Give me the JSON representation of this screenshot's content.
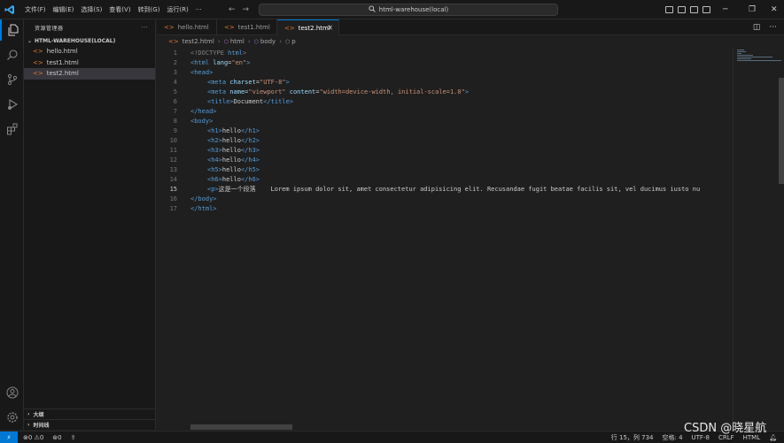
{
  "titlebar": {
    "menu": [
      "文件(F)",
      "编辑(E)",
      "选择(S)",
      "查看(V)",
      "转到(G)",
      "运行(R)",
      "···"
    ],
    "search": "html-warehouse(local)"
  },
  "sidebar": {
    "title": "资源管理器",
    "more": "···",
    "folder": "HTML-WAREHOUSE(LOCAL)",
    "files": [
      "hello.html",
      "test1.html",
      "test2.html"
    ],
    "sections": [
      "大纲",
      "时间线"
    ]
  },
  "tabs": [
    {
      "label": "hello.html"
    },
    {
      "label": "test1.html"
    },
    {
      "label": "test2.html"
    }
  ],
  "breadcrumb": [
    "test2.html",
    "html",
    "body",
    "p"
  ],
  "editor": {
    "line_numbers": [
      "1",
      "2",
      "3",
      "4",
      "5",
      "6",
      "7",
      "8",
      "9",
      "10",
      "11",
      "12",
      "13",
      "14",
      "15",
      "16",
      "17"
    ],
    "lines": {
      "l1a": "<!DOCTYPE ",
      "l1b": "html",
      "l1c": ">",
      "l2a": "<html ",
      "l2b": "lang",
      "l2c": "=",
      "l2d": "\"en\"",
      "l2e": ">",
      "l3": "<head>",
      "l4a": "<meta ",
      "l4b": "charset",
      "l4c": "=",
      "l4d": "\"UTF-8\"",
      "l4e": ">",
      "l5a": "<meta ",
      "l5b": "name",
      "l5c": "=",
      "l5d": "\"viewport\"",
      "l5e": " content",
      "l5f": "=",
      "l5g": "\"width=device-width, initial-scale=1.0\"",
      "l5h": ">",
      "l6a": "<title>",
      "l6b": "Document",
      "l6c": "</title>",
      "l7": "</head>",
      "l8": "<body>",
      "l9a": "<h1>",
      "l9b": "hello",
      "l9c": "</h1>",
      "l10a": "<h2>",
      "l10b": "hello",
      "l10c": "</h2>",
      "l11a": "<h3>",
      "l11b": "hello",
      "l11c": "</h3>",
      "l12a": "<h4>",
      "l12b": "hello",
      "l12c": "</h4>",
      "l13a": "<h5>",
      "l13b": "hello",
      "l13c": "</h5>",
      "l14a": "<h6>",
      "l14b": "hello",
      "l14c": "</h6>",
      "l15a": "<p>",
      "l15b": "这是一个段落",
      "l15c": "    Lorem ipsum dolor sit, amet consectetur adipisicing elit. Recusandae fugit beatae facilis sit, vel ducimus iusto nu",
      "l16": "</body>",
      "l17": "</html>"
    }
  },
  "statusbar": {
    "remote": "⚡",
    "problems": "⊗0 ⚠0",
    "ports": "⊛0",
    "position": "行 15，列 734",
    "spaces": "空格: 4",
    "encoding": "UTF-8",
    "eol": "CRLF",
    "language": "HTML"
  },
  "watermark": "CSDN @晓星航",
  "colors": {
    "accent": "#0078d4",
    "tag": "#569cd6",
    "attr": "#9cdcfe",
    "string": "#ce9178",
    "html_icon": "#e37933"
  }
}
